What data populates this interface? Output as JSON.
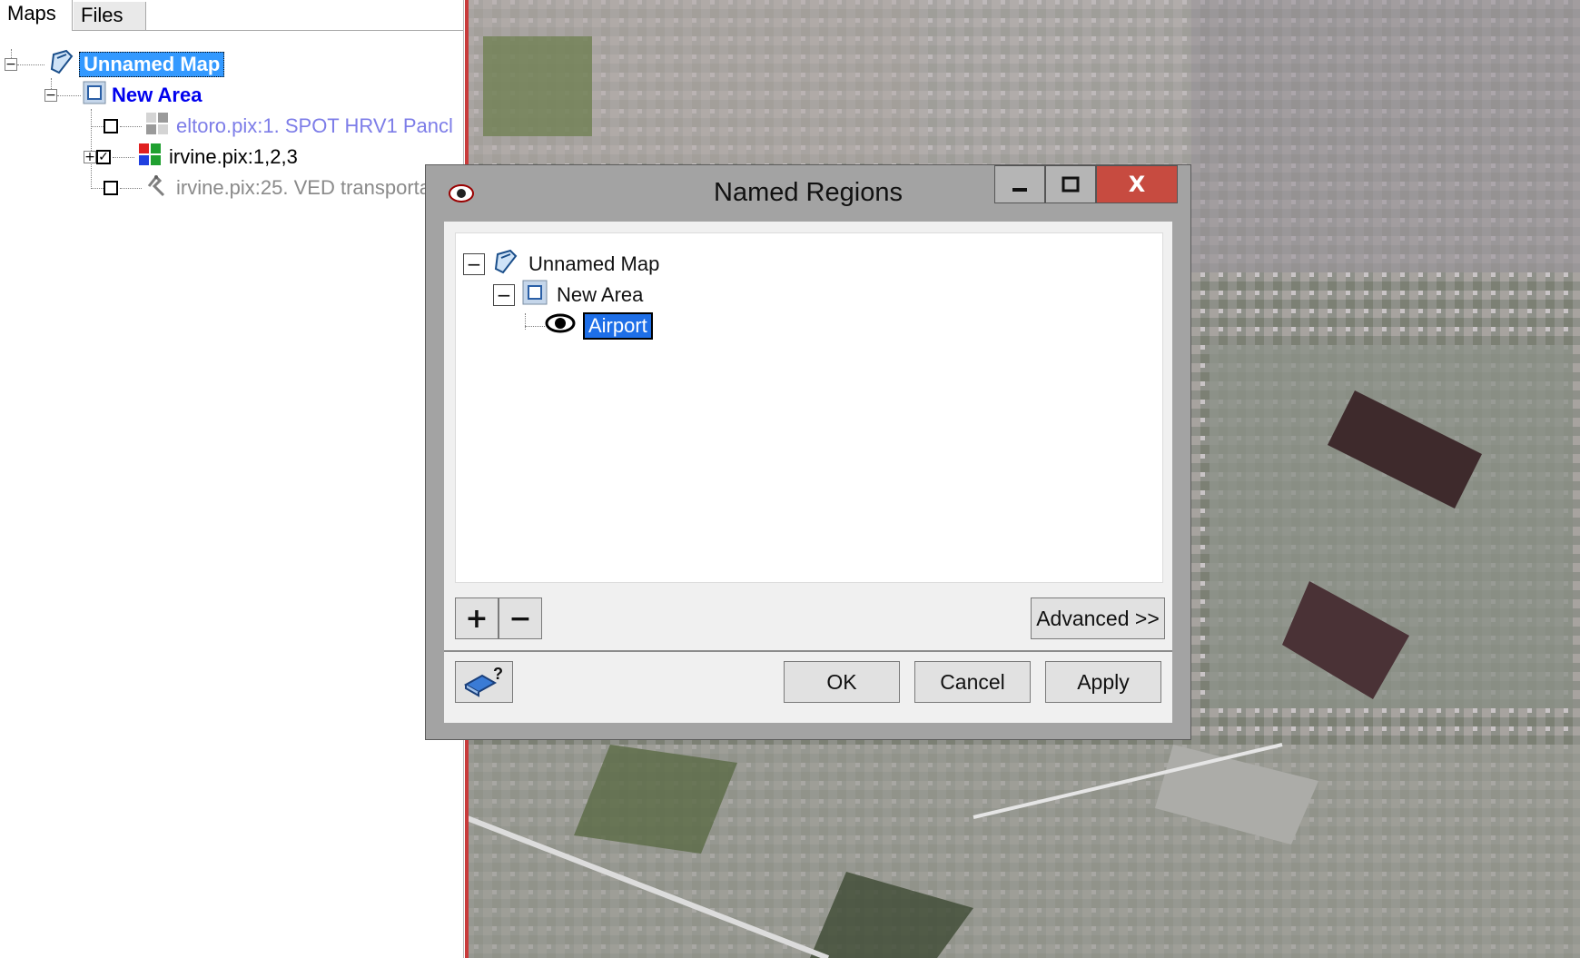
{
  "left_panel": {
    "tabs": [
      {
        "label": "Maps"
      },
      {
        "label": "Files"
      }
    ],
    "tree": {
      "map": {
        "label": "Unnamed Map"
      },
      "area": {
        "label": "New Area"
      },
      "layers": [
        {
          "label": "eltoro.pix:1. SPOT HRV1 Pancl",
          "checked": false
        },
        {
          "label": "irvine.pix:1,2,3",
          "checked": true
        },
        {
          "label": "irvine.pix:25. VED transporta",
          "checked": false
        }
      ]
    }
  },
  "dialog": {
    "title": "Named Regions",
    "window_buttons": {
      "minimize": "–",
      "maximize": "□",
      "close": "X"
    },
    "tree": {
      "map": {
        "label": "Unnamed Map"
      },
      "area": {
        "label": "New Area"
      },
      "region": {
        "label": "Airport"
      }
    },
    "buttons": {
      "add": "+",
      "remove": "−",
      "advanced": "Advanced >>",
      "ok": "OK",
      "cancel": "Cancel",
      "apply": "Apply"
    }
  }
}
